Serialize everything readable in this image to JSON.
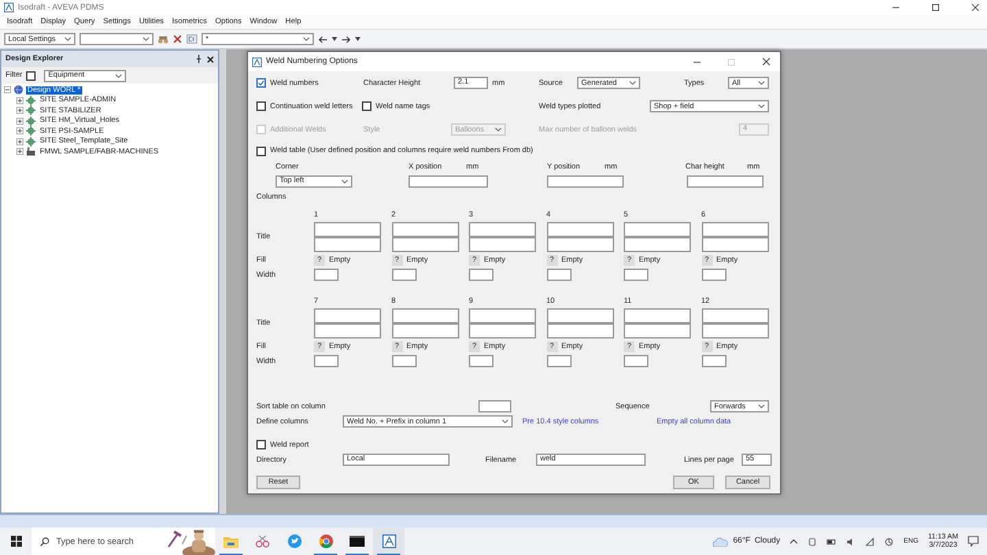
{
  "window": {
    "title": "Isodraft - AVEVA PDMS"
  },
  "menu": [
    "Isodraft",
    "Display",
    "Query",
    "Settings",
    "Utilities",
    "Isometrics",
    "Options",
    "Window",
    "Help"
  ],
  "toolbar": {
    "settings_combo": "Local Settings",
    "command_field": "*"
  },
  "design_explorer": {
    "title": "Design Explorer",
    "filter_label": "Filter",
    "filter_checked": false,
    "filter_combo": "Equipment",
    "tree": [
      {
        "label": "Design WORL *",
        "kind": "world",
        "selected": true,
        "expanded": true,
        "children": [
          {
            "label": "SITE SAMPLE-ADMIN",
            "kind": "site",
            "selected": false,
            "expanded": false
          },
          {
            "label": "SITE STABILIZER",
            "kind": "site",
            "selected": false,
            "expanded": false
          },
          {
            "label": "SITE HM_Virtual_Holes",
            "kind": "site",
            "selected": false,
            "expanded": false
          },
          {
            "label": "SITE PSI-SAMPLE",
            "kind": "site",
            "selected": false,
            "expanded": false
          },
          {
            "label": "SITE Steel_Template_Site",
            "kind": "site",
            "selected": false,
            "expanded": false
          },
          {
            "label": "FMWL SAMPLE/FABR-MACHINES",
            "kind": "machine",
            "selected": false,
            "expanded": false
          }
        ]
      }
    ]
  },
  "dialog": {
    "title": "Weld Numbering Options",
    "weld_numbers": {
      "label": "Weld numbers",
      "checked": true
    },
    "char_height": {
      "label": "Character Height",
      "value": "2.1",
      "unit": "mm"
    },
    "source": {
      "label": "Source",
      "value": "Generated"
    },
    "types": {
      "label": "Types",
      "value": "All"
    },
    "continuation": {
      "label": "Continuation weld letters",
      "checked": false
    },
    "name_tags": {
      "label": "Weld name tags",
      "checked": false
    },
    "types_plotted": {
      "label": "Weld types plotted",
      "value": "Shop + field"
    },
    "additional": {
      "label": "Additional Welds",
      "checked": false,
      "disabled": true
    },
    "style": {
      "label": "Style",
      "value": "Balloons",
      "disabled": true
    },
    "max_balloon": {
      "label": "Max number of balloon welds",
      "value": "4",
      "disabled": true
    },
    "weld_table": {
      "label": "Weld table  (User defined position and columns require weld numbers From db)",
      "checked": false
    },
    "corner": {
      "label": "Corner",
      "value": "Top left"
    },
    "positions": [
      {
        "label": "X position",
        "unit": "mm"
      },
      {
        "label": "Y position",
        "unit": "mm"
      },
      {
        "label": "Char height",
        "unit": "mm"
      }
    ],
    "columns_label": "Columns",
    "column_groups": [
      {
        "title_label": "Title",
        "fill_label": "Fill",
        "width_label": "Width",
        "columns": [
          {
            "number": "1",
            "fill_button": "?",
            "fill": "Empty"
          },
          {
            "number": "2",
            "fill_button": "?",
            "fill": "Empty"
          },
          {
            "number": "3",
            "fill_button": "?",
            "fill": "Empty"
          },
          {
            "number": "4",
            "fill_button": "?",
            "fill": "Empty"
          },
          {
            "number": "5",
            "fill_button": "?",
            "fill": "Empty"
          },
          {
            "number": "6",
            "fill_button": "?",
            "fill": "Empty"
          }
        ]
      },
      {
        "title_label": "Title",
        "fill_label": "Fill",
        "width_label": "Width",
        "columns": [
          {
            "number": "7",
            "fill_button": "?",
            "fill": "Empty"
          },
          {
            "number": "8",
            "fill_button": "?",
            "fill": "Empty"
          },
          {
            "number": "9",
            "fill_button": "?",
            "fill": "Empty"
          },
          {
            "number": "10",
            "fill_button": "?",
            "fill": "Empty"
          },
          {
            "number": "11",
            "fill_button": "?",
            "fill": "Empty"
          },
          {
            "number": "12",
            "fill_button": "?",
            "fill": "Empty"
          }
        ]
      }
    ],
    "sort": {
      "label": "Sort table on column"
    },
    "sequence": {
      "label": "Sequence",
      "value": "Forwards"
    },
    "define": {
      "label": "Define columns",
      "value": "Weld No. + Prefix in column 1"
    },
    "links": [
      "Pre 10.4 style columns",
      "Empty all column data"
    ],
    "weld_report": {
      "label": "Weld report",
      "checked": false
    },
    "directory": {
      "label": "Directory",
      "value": "Local"
    },
    "filename": {
      "label": "Filename",
      "value": "weld"
    },
    "lines": {
      "label": "Lines per page",
      "value": "55"
    },
    "buttons": {
      "reset": "Reset",
      "ok": "OK",
      "cancel": "Cancel"
    }
  },
  "taskbar": {
    "search": {
      "placeholder": "Type here to search"
    },
    "apps": [
      {
        "kind": "folder",
        "running": true,
        "active": false
      },
      {
        "kind": "snip",
        "running": false,
        "active": false
      },
      {
        "kind": "bird",
        "running": false,
        "active": false
      },
      {
        "kind": "browser",
        "running": true,
        "active": false
      },
      {
        "kind": "terminal",
        "running": true,
        "active": false
      },
      {
        "kind": "aveva",
        "running": true,
        "active": true
      }
    ],
    "weather": {
      "temperature": "66°F",
      "condition": "Cloudy"
    },
    "language": "ENG",
    "time": "11:13 AM",
    "date": "3/7/2023"
  }
}
